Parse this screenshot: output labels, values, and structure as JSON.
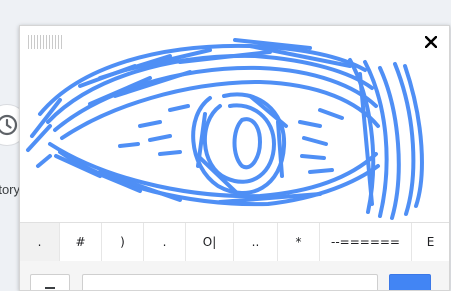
{
  "background": {
    "history_icon": "history-icon",
    "history_label": "tory"
  },
  "handwriting_panel": {
    "close_icon": "close-icon",
    "drag_handle_icon": "drag-handle-icon",
    "ink_color": "#4f8ff5",
    "suggestions": [
      ".",
      "#",
      ")",
      ".",
      "O|",
      "..",
      "*",
      "--======",
      "E"
    ],
    "backspace_icon": "backspace-icon",
    "enter_color": "#4285f4"
  }
}
